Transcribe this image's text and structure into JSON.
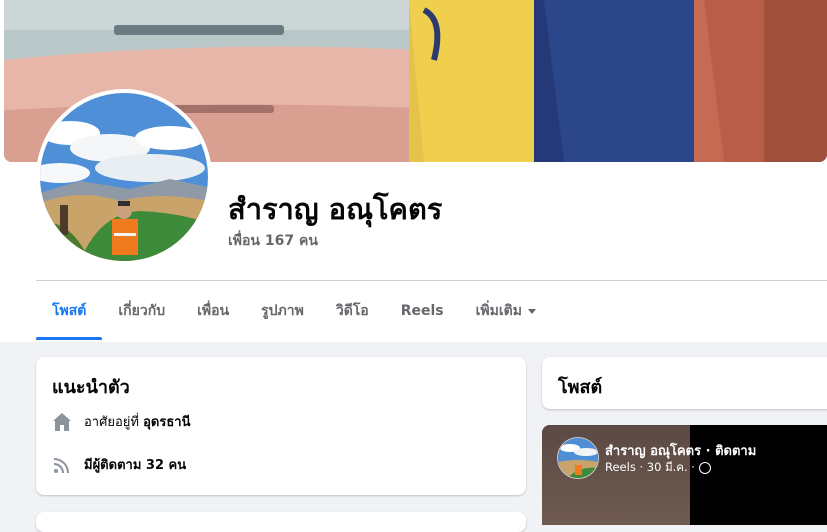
{
  "profile": {
    "name": "สำราญ อณุโคตร",
    "friends": "เพื่อน 167 คน"
  },
  "tabs": [
    {
      "label": "โพสต์",
      "active": true
    },
    {
      "label": "เกี่ยวกับ"
    },
    {
      "label": "เพื่อน"
    },
    {
      "label": "รูปภาพ"
    },
    {
      "label": "วิดีโอ"
    },
    {
      "label": "Reels"
    },
    {
      "label": "เพิ่มเติม"
    }
  ],
  "intro": {
    "title": "แนะนำตัว",
    "lives_prefix": "อาศัยอยู่ที่",
    "lives_place": "อุดรธานี",
    "followers": "มีผู้ติดตาม 32 คน",
    "home_icon": "home-icon",
    "followers_icon": "rss-icon"
  },
  "posts": {
    "title": "โพสต์"
  },
  "reel": {
    "author_line": "สำราญ อณุโคตร · ติดตาม",
    "meta": "Reels · 30 มี.ค. ·",
    "privacy_icon": "globe-icon"
  },
  "colors": {
    "accent": "#1877f2",
    "background": "#f0f2f5",
    "secondary_text": "#65676b"
  }
}
